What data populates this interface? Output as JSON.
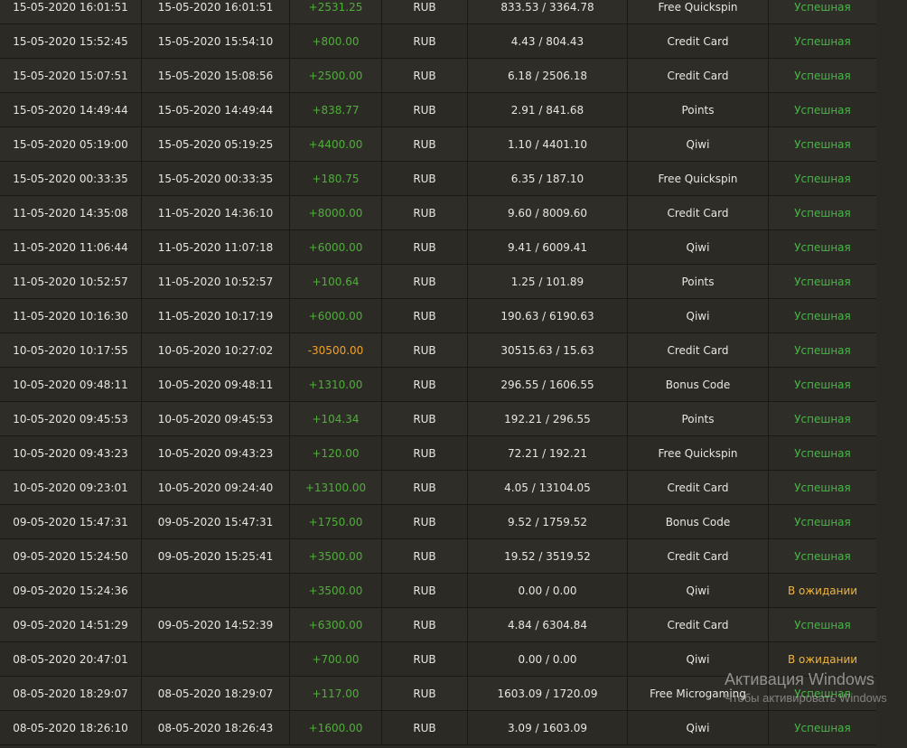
{
  "transactions": [
    {
      "created": "15-05-2020 16:01:51",
      "processed": "15-05-2020 16:01:51",
      "amount": "+2531.25",
      "currency": "RUB",
      "balance": "833.53 / 3364.78",
      "method": "Free Quickspin",
      "status": "Успешная"
    },
    {
      "created": "15-05-2020 15:52:45",
      "processed": "15-05-2020 15:54:10",
      "amount": "+800.00",
      "currency": "RUB",
      "balance": "4.43 / 804.43",
      "method": "Credit Card",
      "status": "Успешная"
    },
    {
      "created": "15-05-2020 15:07:51",
      "processed": "15-05-2020 15:08:56",
      "amount": "+2500.00",
      "currency": "RUB",
      "balance": "6.18 / 2506.18",
      "method": "Credit Card",
      "status": "Успешная"
    },
    {
      "created": "15-05-2020 14:49:44",
      "processed": "15-05-2020 14:49:44",
      "amount": "+838.77",
      "currency": "RUB",
      "balance": "2.91 / 841.68",
      "method": "Points",
      "status": "Успешная"
    },
    {
      "created": "15-05-2020 05:19:00",
      "processed": "15-05-2020 05:19:25",
      "amount": "+4400.00",
      "currency": "RUB",
      "balance": "1.10 / 4401.10",
      "method": "Qiwi",
      "status": "Успешная"
    },
    {
      "created": "15-05-2020 00:33:35",
      "processed": "15-05-2020 00:33:35",
      "amount": "+180.75",
      "currency": "RUB",
      "balance": "6.35 / 187.10",
      "method": "Free Quickspin",
      "status": "Успешная"
    },
    {
      "created": "11-05-2020 14:35:08",
      "processed": "11-05-2020 14:36:10",
      "amount": "+8000.00",
      "currency": "RUB",
      "balance": "9.60 / 8009.60",
      "method": "Credit Card",
      "status": "Успешная"
    },
    {
      "created": "11-05-2020 11:06:44",
      "processed": "11-05-2020 11:07:18",
      "amount": "+6000.00",
      "currency": "RUB",
      "balance": "9.41 / 6009.41",
      "method": "Qiwi",
      "status": "Успешная"
    },
    {
      "created": "11-05-2020 10:52:57",
      "processed": "11-05-2020 10:52:57",
      "amount": "+100.64",
      "currency": "RUB",
      "balance": "1.25 / 101.89",
      "method": "Points",
      "status": "Успешная"
    },
    {
      "created": "11-05-2020 10:16:30",
      "processed": "11-05-2020 10:17:19",
      "amount": "+6000.00",
      "currency": "RUB",
      "balance": "190.63 / 6190.63",
      "method": "Qiwi",
      "status": "Успешная"
    },
    {
      "created": "10-05-2020 10:17:55",
      "processed": "10-05-2020 10:27:02",
      "amount": "-30500.00",
      "currency": "RUB",
      "balance": "30515.63 / 15.63",
      "method": "Credit Card",
      "status": "Успешная"
    },
    {
      "created": "10-05-2020 09:48:11",
      "processed": "10-05-2020 09:48:11",
      "amount": "+1310.00",
      "currency": "RUB",
      "balance": "296.55 / 1606.55",
      "method": "Bonus Code",
      "status": "Успешная"
    },
    {
      "created": "10-05-2020 09:45:53",
      "processed": "10-05-2020 09:45:53",
      "amount": "+104.34",
      "currency": "RUB",
      "balance": "192.21 / 296.55",
      "method": "Points",
      "status": "Успешная"
    },
    {
      "created": "10-05-2020 09:43:23",
      "processed": "10-05-2020 09:43:23",
      "amount": "+120.00",
      "currency": "RUB",
      "balance": "72.21 / 192.21",
      "method": "Free Quickspin",
      "status": "Успешная"
    },
    {
      "created": "10-05-2020 09:23:01",
      "processed": "10-05-2020 09:24:40",
      "amount": "+13100.00",
      "currency": "RUB",
      "balance": "4.05 / 13104.05",
      "method": "Credit Card",
      "status": "Успешная"
    },
    {
      "created": "09-05-2020 15:47:31",
      "processed": "09-05-2020 15:47:31",
      "amount": "+1750.00",
      "currency": "RUB",
      "balance": "9.52 / 1759.52",
      "method": "Bonus Code",
      "status": "Успешная"
    },
    {
      "created": "09-05-2020 15:24:50",
      "processed": "09-05-2020 15:25:41",
      "amount": "+3500.00",
      "currency": "RUB",
      "balance": "19.52 / 3519.52",
      "method": "Credit Card",
      "status": "Успешная"
    },
    {
      "created": "09-05-2020 15:24:36",
      "processed": "",
      "amount": "+3500.00",
      "currency": "RUB",
      "balance": "0.00 / 0.00",
      "method": "Qiwi",
      "status": "В ожидании"
    },
    {
      "created": "09-05-2020 14:51:29",
      "processed": "09-05-2020 14:52:39",
      "amount": "+6300.00",
      "currency": "RUB",
      "balance": "4.84 / 6304.84",
      "method": "Credit Card",
      "status": "Успешная"
    },
    {
      "created": "08-05-2020 20:47:01",
      "processed": "",
      "amount": "+700.00",
      "currency": "RUB",
      "balance": "0.00 / 0.00",
      "method": "Qiwi",
      "status": "В ожидании"
    },
    {
      "created": "08-05-2020 18:29:07",
      "processed": "08-05-2020 18:29:07",
      "amount": "+117.00",
      "currency": "RUB",
      "balance": "1603.09 / 1720.09",
      "method": "Free Microgaming",
      "status": "Успешная"
    },
    {
      "created": "08-05-2020 18:26:10",
      "processed": "08-05-2020 18:26:43",
      "amount": "+1600.00",
      "currency": "RUB",
      "balance": "3.09 / 1603.09",
      "method": "Qiwi",
      "status": "Успешная"
    }
  ],
  "colors": {
    "positive": "#4fae3b",
    "negative": "#f0a22a",
    "success": "#48b548",
    "pending": "#f0b43a",
    "background": "#2b2924"
  },
  "watermark": {
    "title": "Активация Windows",
    "subtitle": "Чтобы активировать Windows"
  }
}
